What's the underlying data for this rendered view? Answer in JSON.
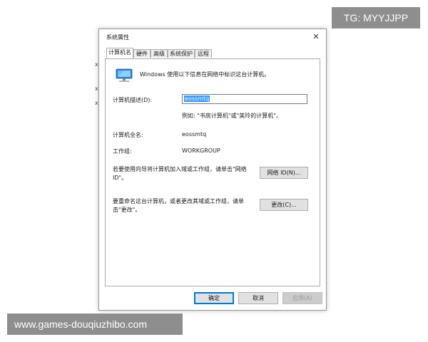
{
  "background": {
    "cut_text_1": "x",
    "cut_text_2": "x",
    "cut_text_3": "x"
  },
  "watermarks": {
    "top": "TG: MYYJJPP",
    "bottom": "www.games-douqiuzhibo.com"
  },
  "dialog": {
    "title": "系统属性",
    "close_glyph": "✕",
    "tabs": [
      {
        "label": "计算机名",
        "active": true
      },
      {
        "label": "硬件",
        "active": false
      },
      {
        "label": "高级",
        "active": false
      },
      {
        "label": "系统保护",
        "active": false
      },
      {
        "label": "远程",
        "active": false
      }
    ],
    "intro_text": "Windows 使用以下信息在网络中标识这台计算机。",
    "desc_label": "计算机描述(D):",
    "desc_value": "eossmtq",
    "desc_hint": "例如: \"书房计算机\"或\"美玲的计算机\"。",
    "fullname_label": "计算机全名:",
    "fullname_value": "eossmtq",
    "workgroup_label": "工作组:",
    "workgroup_value": "WORKGROUP",
    "network_text": "若要使用向导将计算机加入域或工作组，请单击\"网络 ID\"。",
    "network_button": "网络 ID(N)...",
    "rename_text": "要重命名这台计算机，或者更改其域或工作组，请单击\"更改\"。",
    "change_button": "更改(C)...",
    "ok_button": "确定",
    "cancel_button": "取消",
    "apply_button": "应用(A)",
    "icon": "computer-monitor-icon",
    "accent_color": "#0078d7"
  }
}
